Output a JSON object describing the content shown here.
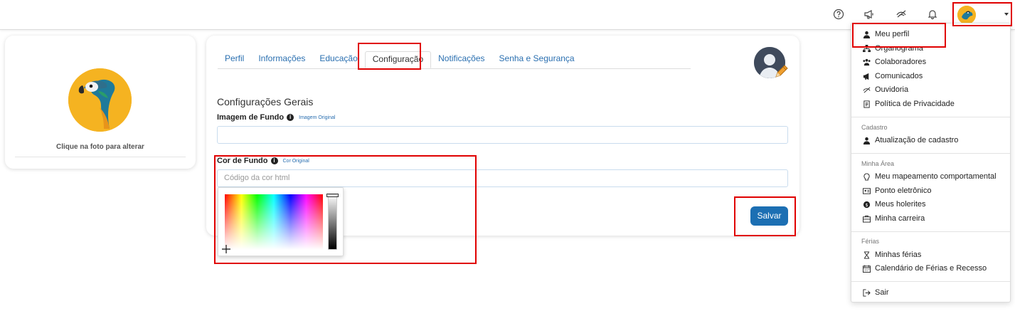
{
  "topbar": {
    "icons": [
      "help-icon",
      "megaphone-icon",
      "ouvidoria-icon",
      "bell-icon"
    ]
  },
  "left_card": {
    "change_photo_text": "Clique na foto para alterar"
  },
  "tabs": [
    {
      "label": "Perfil",
      "active": false
    },
    {
      "label": "Informações",
      "active": false
    },
    {
      "label": "Educação",
      "active": false
    },
    {
      "label": "Configuração",
      "active": true
    },
    {
      "label": "Notificações",
      "active": false
    },
    {
      "label": "Senha e Segurança",
      "active": false
    }
  ],
  "settings": {
    "title": "Configurações Gerais",
    "background_image_label": "Imagem de Fundo",
    "background_image_link": "Imagem Original",
    "background_image_value": "",
    "background_color_label": "Cor de Fundo",
    "background_color_link": "Cor Original",
    "background_color_placeholder": "Código da cor html",
    "save_label": "Salvar"
  },
  "dropdown": {
    "items": [
      {
        "label": "Meu perfil",
        "icon": "user-icon"
      },
      {
        "label": "Organograma",
        "icon": "org-chart-icon"
      },
      {
        "label": "Colaboradores",
        "icon": "users-icon"
      },
      {
        "label": "Comunicados",
        "icon": "megaphone-icon"
      },
      {
        "label": "Ouvidoria",
        "icon": "ouvidoria-icon"
      },
      {
        "label": "Política de Privacidade",
        "icon": "document-icon"
      }
    ],
    "section_cadastro": "Cadastro",
    "cadastro_items": [
      {
        "label": "Atualização de cadastro",
        "icon": "user-icon"
      }
    ],
    "section_minha_area": "Minha Área",
    "minha_area_items": [
      {
        "label": "Meu mapeamento comportamental",
        "icon": "brain-icon"
      },
      {
        "label": "Ponto eletrônico",
        "icon": "id-card-icon"
      },
      {
        "label": "Meus holerites",
        "icon": "money-icon"
      },
      {
        "label": "Minha carreira",
        "icon": "briefcase-icon"
      }
    ],
    "section_ferias": "Férias",
    "ferias_items": [
      {
        "label": "Minhas férias",
        "icon": "hourglass-icon"
      },
      {
        "label": "Calendário de Férias e Recesso",
        "icon": "calendar-icon"
      }
    ],
    "logout_label": "Sair"
  },
  "colors": {
    "accent": "#1c6fb3",
    "link": "#2a6fb0",
    "highlight": "#e00000",
    "avatar_bg": "#f5b321"
  }
}
